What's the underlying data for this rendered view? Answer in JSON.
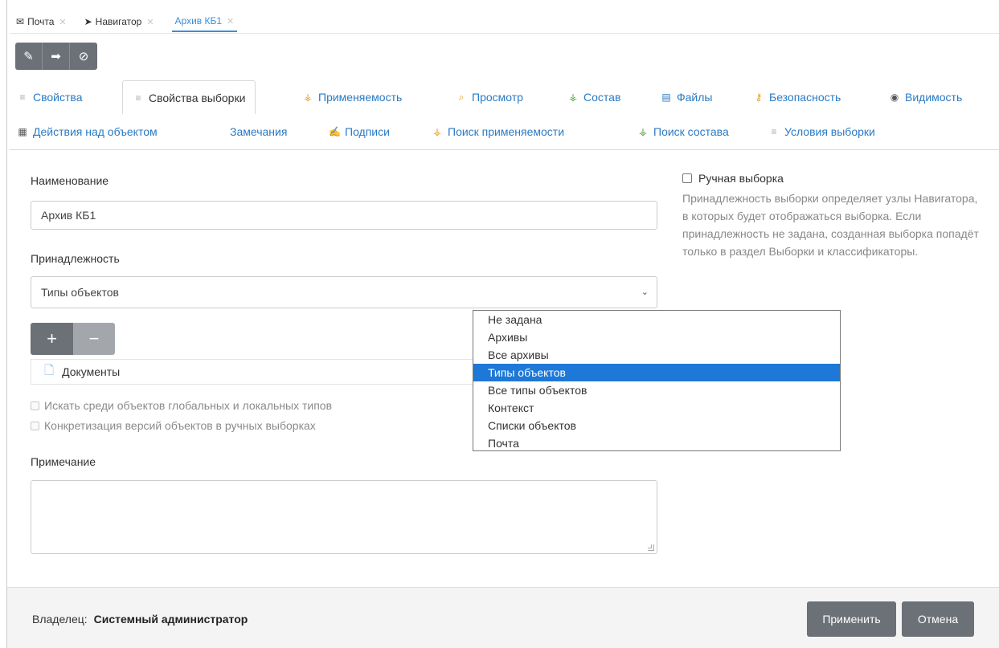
{
  "doc_tabs": [
    {
      "label": "Почта",
      "icon": "envelope-icon"
    },
    {
      "label": "Навигатор",
      "icon": "navigation-arrow-icon"
    },
    {
      "label": "Архив КБ1",
      "icon": ""
    }
  ],
  "toolbar": [
    {
      "name": "edit-button",
      "icon": "pencil-icon"
    },
    {
      "name": "forward-button",
      "icon": "arrow-right-icon"
    },
    {
      "name": "cancel-button",
      "icon": "no-entry-icon"
    }
  ],
  "prop_tabs_row1": [
    "Свойства",
    "Свойства выборки",
    "Применяемость",
    "Просмотр",
    "Состав",
    "Файлы",
    "Безопасность",
    "Видимость"
  ],
  "prop_tabs_row2": [
    "Действия над объектом",
    "Замечания",
    "Подписи",
    "Поиск применяемости",
    "Поиск состава",
    "Условия выборки"
  ],
  "form": {
    "name_label": "Наименование",
    "name_value": "Архив КБ1",
    "belong_label": "Принадлежность",
    "belong_value": "Типы объектов",
    "plus": "+",
    "minus": "−",
    "doc_item": "Документы",
    "check_global": "Искать среди объектов глобальных и локальных типов",
    "check_versions": "Конкретизация версий объектов в ручных выборках",
    "note_label": "Примечание"
  },
  "right": {
    "manual_label": "Ручная выборка",
    "help_text": "Принадлежность выборки определяет узлы Навигатора, в которых будет отображаться выборка. Если принадлежность не задана, созданная выборка попадёт только в раздел Выборки и классификаторы."
  },
  "dropdown": {
    "options": [
      "Не задана",
      "Архивы",
      "Все архивы",
      "Типы объектов",
      "Все типы объектов",
      "Контекст",
      "Списки объектов",
      "Почта"
    ],
    "selected": "Типы объектов"
  },
  "footer": {
    "owner_label": "Владелец:",
    "owner_value": "Системный администратор",
    "apply": "Применить",
    "cancel": "Отмена"
  },
  "colors": {
    "accent": "#2a7ac4",
    "selected": "#1e78d7",
    "button": "#6c7178"
  }
}
